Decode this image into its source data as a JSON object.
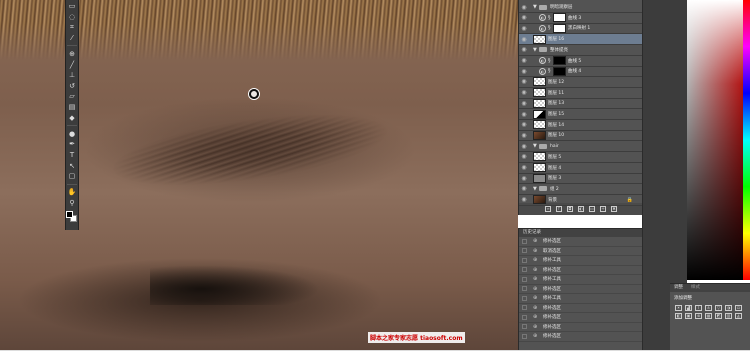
{
  "toolbar": {
    "tools": [
      "marquee-icon",
      "lasso-icon",
      "crop-icon",
      "eyedropper-icon",
      "spot-healing-icon",
      "brush-icon",
      "clone-stamp-icon",
      "history-brush-icon",
      "eraser-icon",
      "gradient-icon",
      "blur-icon",
      "dodge-icon",
      "pen-icon",
      "type-icon",
      "path-select-icon",
      "rectangle-icon",
      "hand-icon",
      "zoom-icon"
    ],
    "foreground_color": "#000000",
    "background_color": "#ffffff"
  },
  "layers": {
    "items": [
      {
        "name": "明暗观察层",
        "type": "group",
        "indent": 0
      },
      {
        "name": "曲线 3",
        "type": "adjust",
        "thumb": "white",
        "indent": 1
      },
      {
        "name": "黑白映射 1",
        "type": "adjust",
        "thumb": "white",
        "indent": 1
      },
      {
        "name": "图层 16",
        "type": "layer",
        "thumb": "checker",
        "indent": 0,
        "selected": true
      },
      {
        "name": "整体提亮",
        "type": "group",
        "indent": 0
      },
      {
        "name": "曲线 5",
        "type": "adjust",
        "thumb": "black",
        "indent": 1
      },
      {
        "name": "曲线 4",
        "type": "adjust",
        "thumb": "black",
        "indent": 1
      },
      {
        "name": "图层 12",
        "type": "layer",
        "thumb": "checker",
        "indent": 0
      },
      {
        "name": "图层 11",
        "type": "layer",
        "thumb": "checker",
        "indent": 0
      },
      {
        "name": "图层 13",
        "type": "layer",
        "thumb": "checker",
        "indent": 0
      },
      {
        "name": "图层 15",
        "type": "layer",
        "thumb": "diag",
        "indent": 0
      },
      {
        "name": "图层 14",
        "type": "layer",
        "thumb": "checker",
        "indent": 0
      },
      {
        "name": "图层 10",
        "type": "layer",
        "thumb": "photo",
        "indent": 0
      },
      {
        "name": "hair",
        "type": "group",
        "indent": 0
      },
      {
        "name": "图层 5",
        "type": "layer",
        "thumb": "checker",
        "indent": 0
      },
      {
        "name": "图层 4",
        "type": "layer",
        "thumb": "checker",
        "indent": 0
      },
      {
        "name": "图层 3",
        "type": "layer",
        "thumb": "gray",
        "indent": 0
      },
      {
        "name": "组 2",
        "type": "group",
        "indent": 0
      },
      {
        "name": "背景",
        "type": "layer",
        "thumb": "photo",
        "indent": 0,
        "locked": true
      }
    ],
    "footer_icons": [
      "link-icon",
      "fx-icon",
      "mask-icon",
      "adjustment-icon",
      "group-icon",
      "new-layer-icon",
      "trash-icon"
    ]
  },
  "history": {
    "tab": "历史记录",
    "items": [
      "修补选区",
      "取消选区",
      "修补工具",
      "修补选区",
      "修补工具",
      "修补选区",
      "修补工具",
      "修补选区",
      "修补选区",
      "修补选区",
      "修补选区"
    ]
  },
  "adjustments": {
    "tabs": [
      "调整",
      "样式"
    ],
    "title": "添加调整",
    "icons": [
      "brightness-icon",
      "levels-icon",
      "curves-icon",
      "exposure-icon",
      "vibrance-icon",
      "hue-icon",
      "color-balance-icon",
      "bw-icon",
      "photo-filter-icon",
      "channel-mixer-icon",
      "lookup-icon",
      "invert-icon",
      "posterize-icon",
      "threshold-icon"
    ]
  },
  "watermark": "脚本之家专家志愿 tiaosoft.com"
}
